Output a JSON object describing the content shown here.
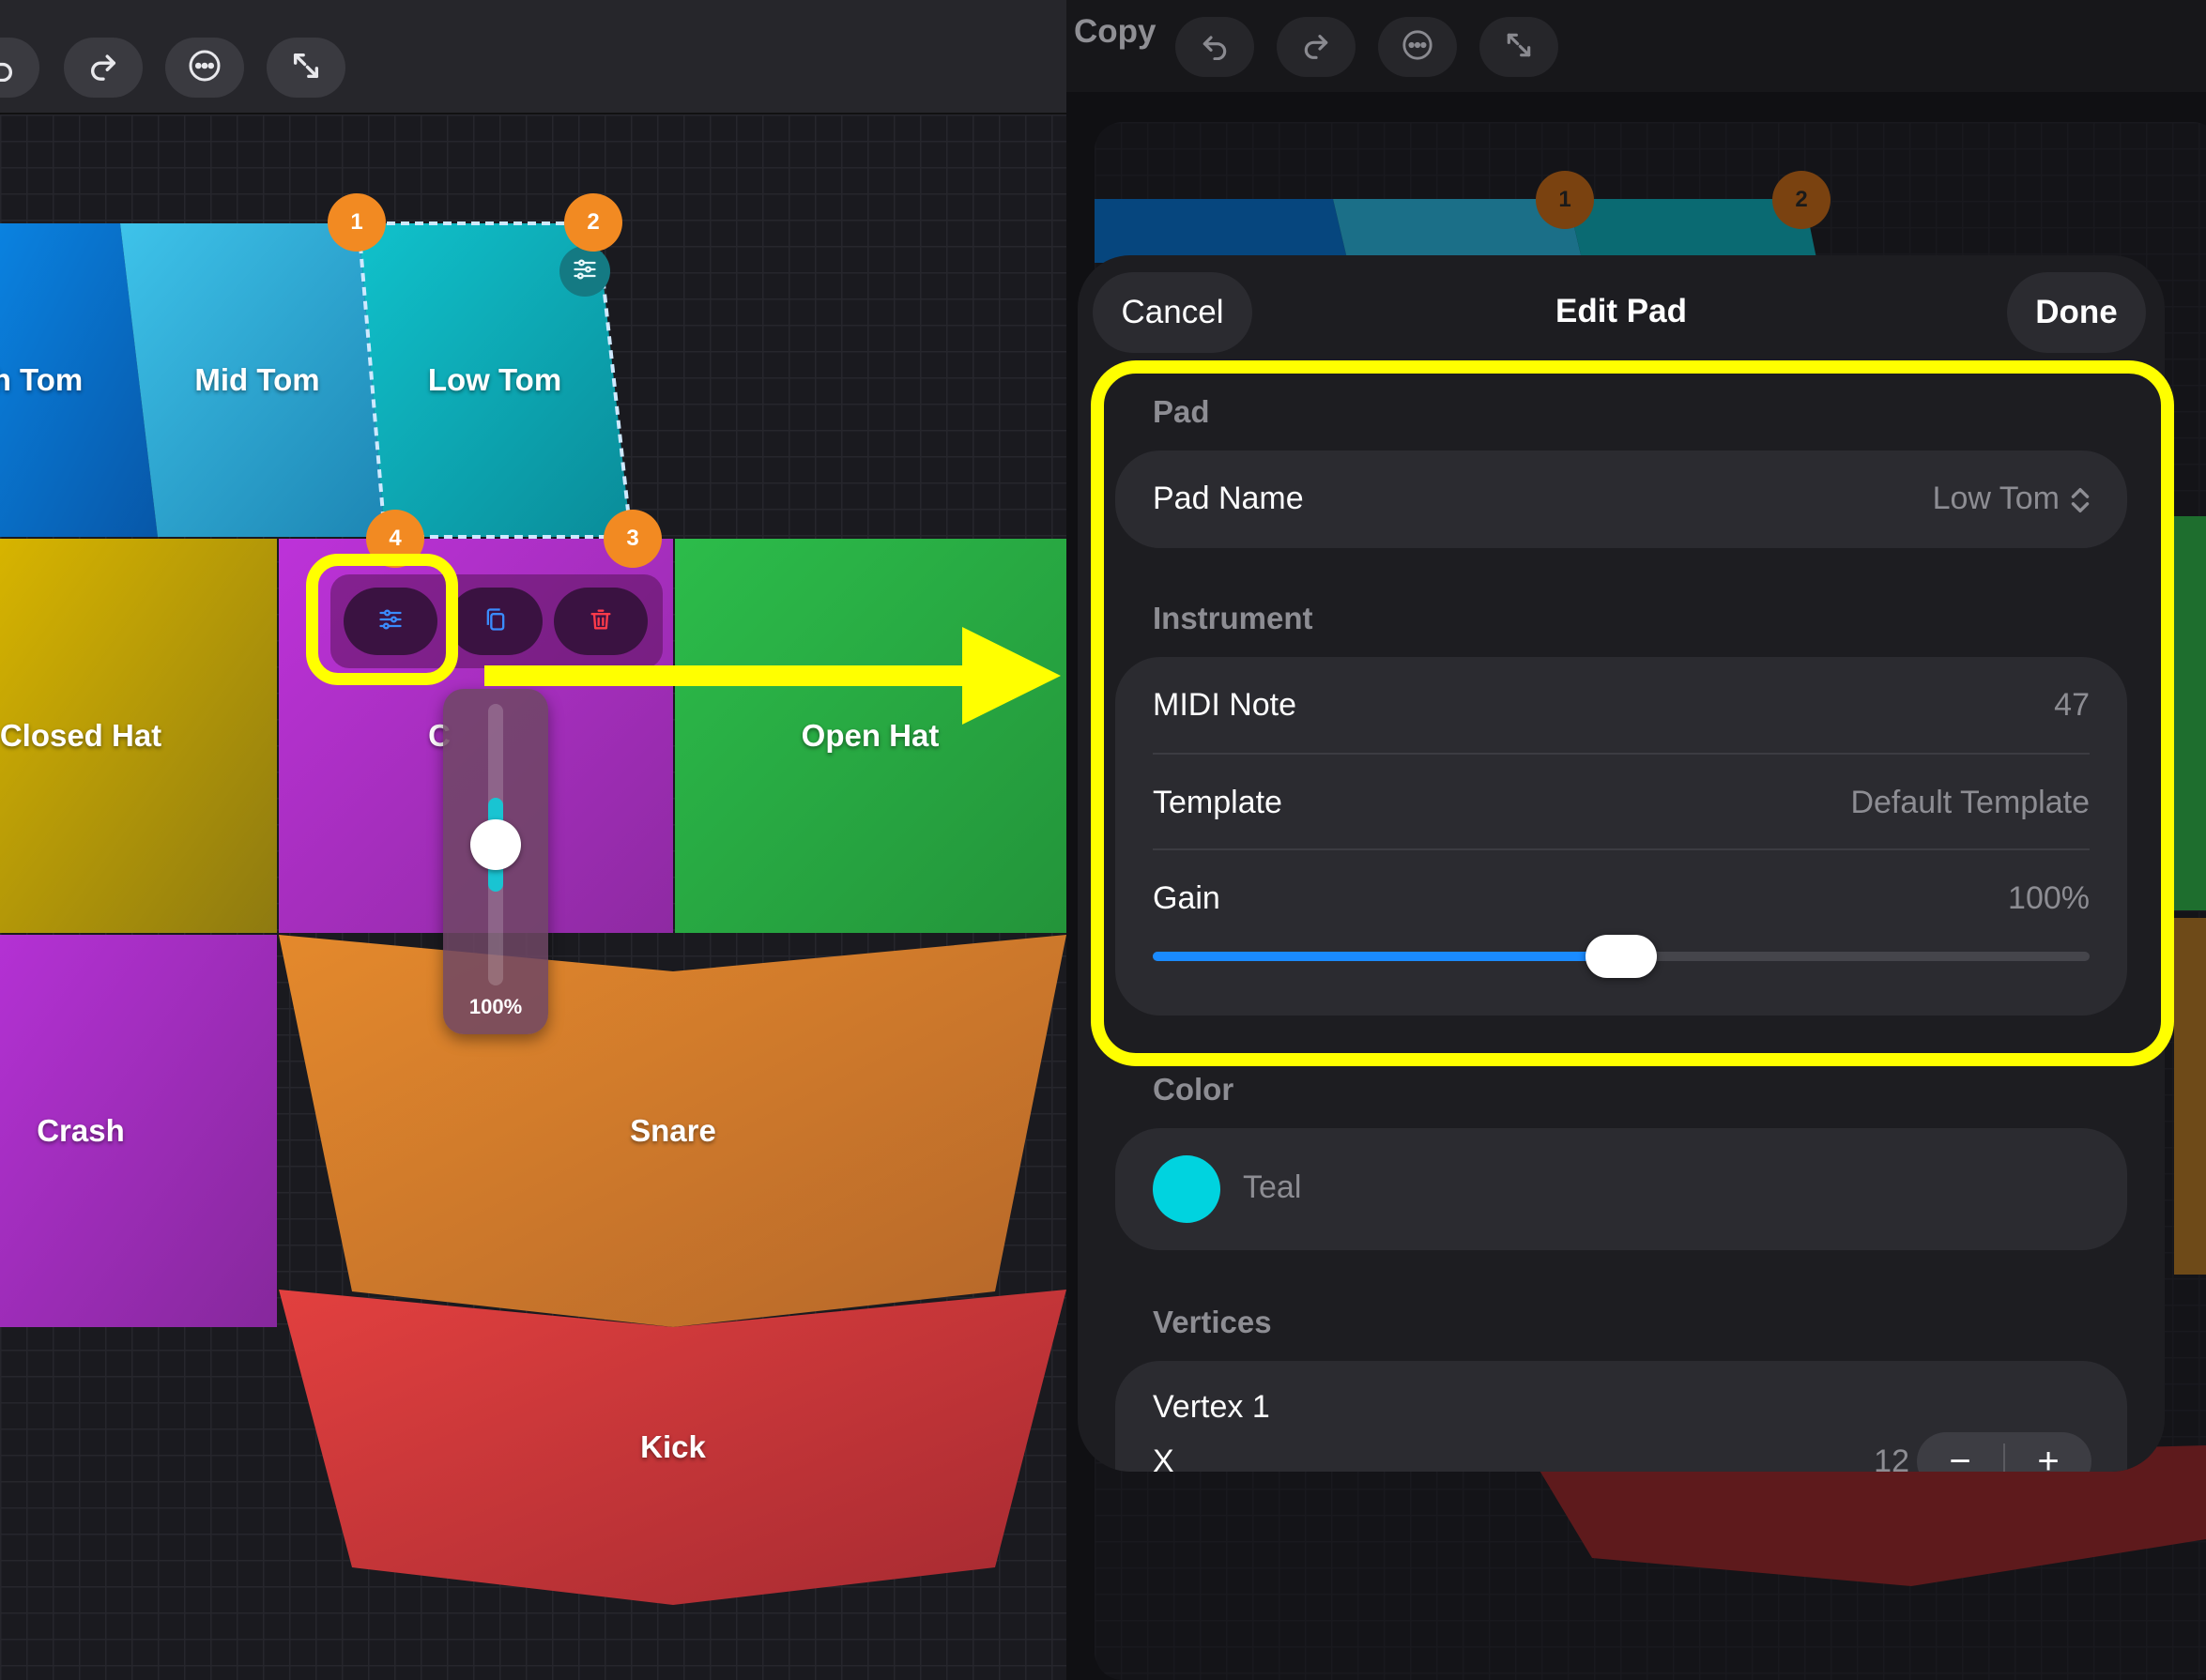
{
  "left_panel": {
    "toolbar": {
      "icons": [
        "undo-icon",
        "redo-icon",
        "more-icon",
        "expand-icon"
      ]
    },
    "pads": {
      "high_tom": "h Tom",
      "mid_tom": "Mid Tom",
      "low_tom": "Low Tom",
      "closed_hat": "Closed Hat",
      "center_partial": "C",
      "open_hat": "Open Hat",
      "crash": "Crash",
      "snare": "Snare",
      "kick": "Kick"
    },
    "vertex_handles": [
      "1",
      "2",
      "3",
      "4"
    ],
    "pad_actions": {
      "icons": [
        "sliders-icon",
        "copy-icon",
        "trash-icon"
      ]
    },
    "gain_popover": {
      "value_label": "100%",
      "level": 0.5
    }
  },
  "right_panel": {
    "toolbar": {
      "copy_label": "Copy",
      "icons": [
        "undo-icon",
        "redo-icon",
        "more-icon",
        "expand-icon"
      ]
    },
    "background_vertex_handles": [
      "1",
      "2"
    ],
    "sheet": {
      "cancel_label": "Cancel",
      "title": "Edit Pad",
      "done_label": "Done",
      "pad_section": {
        "header": "Pad",
        "pad_name_label": "Pad Name",
        "pad_name_value": "Low Tom"
      },
      "instrument_section": {
        "header": "Instrument",
        "midi_note_label": "MIDI Note",
        "midi_note_value": "47",
        "template_label": "Template",
        "template_value": "Default Template",
        "gain_label": "Gain",
        "gain_value": "100%",
        "gain_slider_fraction": 0.5
      },
      "color_section": {
        "header": "Color",
        "color_name": "Teal",
        "swatch_color": "#00d3df"
      },
      "vertices_section": {
        "header": "Vertices",
        "vertex_title": "Vertex 1",
        "x_label": "X",
        "x_value": "12",
        "minus_label": "−",
        "plus_label": "+"
      }
    }
  },
  "annotation": {
    "highlight_color": "#ffff00"
  }
}
